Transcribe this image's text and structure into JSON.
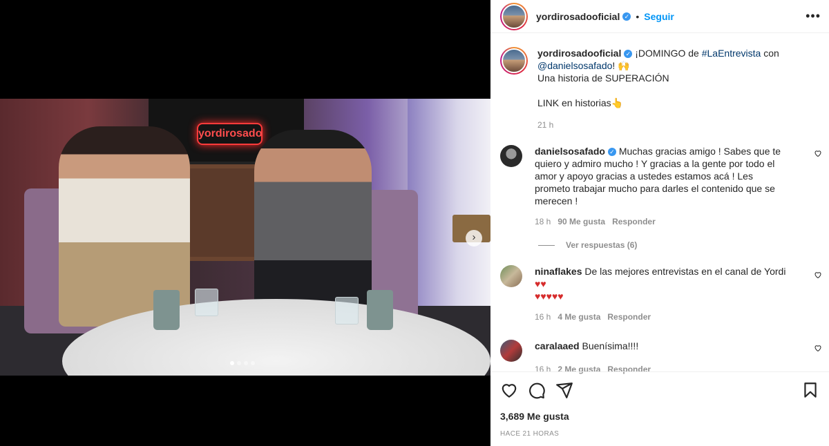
{
  "post": {
    "author": "yordirosadooficial",
    "follow_label": "Seguir",
    "dot": "•",
    "more": "•••"
  },
  "media": {
    "tv_logo": "yordirosado",
    "next": "›"
  },
  "caption": {
    "author": "yordirosadooficial",
    "text_part1": "¡DOMINGO de ",
    "hashtag": "#LaEntrevista",
    "text_part2": " con",
    "mention": "@danielsosafado",
    "text_part3": "! 🙌",
    "line2": "Una historia de SUPERACIÓN",
    "line3": "LINK en historias👆",
    "time": "21 h"
  },
  "comments": [
    {
      "user": "danielsosafado",
      "verified": true,
      "text": "Muchas gracias amigo ! Sabes que te quiero y admiro mucho ! Y gracias a la gente por todo el amor y apoyo gracias a ustedes estamos acá ! Les prometo trabajar mucho para darles el contenido que se merecen !",
      "time": "18 h",
      "likes": "90 Me gusta",
      "reply": "Responder",
      "view_replies": "Ver respuestas (6)"
    },
    {
      "user": "ninaflakes",
      "text": "De las mejores entrevistas en el canal de Yordi ",
      "hearts_inline": "♥♥",
      "hearts_line": "♥♥♥♥♥",
      "time": "16 h",
      "likes": "4 Me gusta",
      "reply": "Responder"
    },
    {
      "user": "caralaaed",
      "text": "Buenísima!!!!",
      "time": "16 h",
      "likes": "2 Me gusta",
      "reply": "Responder"
    }
  ],
  "footer": {
    "likes": "3,689 Me gusta",
    "ago": "HACE 21 HORAS"
  },
  "colors": {
    "accent": "#0095f6",
    "verified": "#3897f0",
    "heart": "#d62c2c"
  }
}
